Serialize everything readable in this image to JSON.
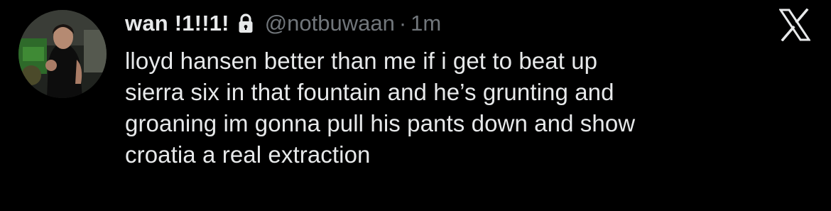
{
  "tweet": {
    "display_name": "wan !1!!1!",
    "handle": "@notbuwaan",
    "separator": "·",
    "timestamp": "1m",
    "protected_icon": "lock-icon",
    "platform_icon": "x-logo-icon",
    "avatar_icon": "profile-photo",
    "text": "lloyd hansen better than me if i get to beat up\nsierra six in that fountain and he’s grunting and\ngroaning im gonna pull his pants down and show\ncroatia a real extraction"
  },
  "colors": {
    "background": "#000000",
    "primary_text": "#e7e9ea",
    "secondary_text": "#71767b"
  }
}
